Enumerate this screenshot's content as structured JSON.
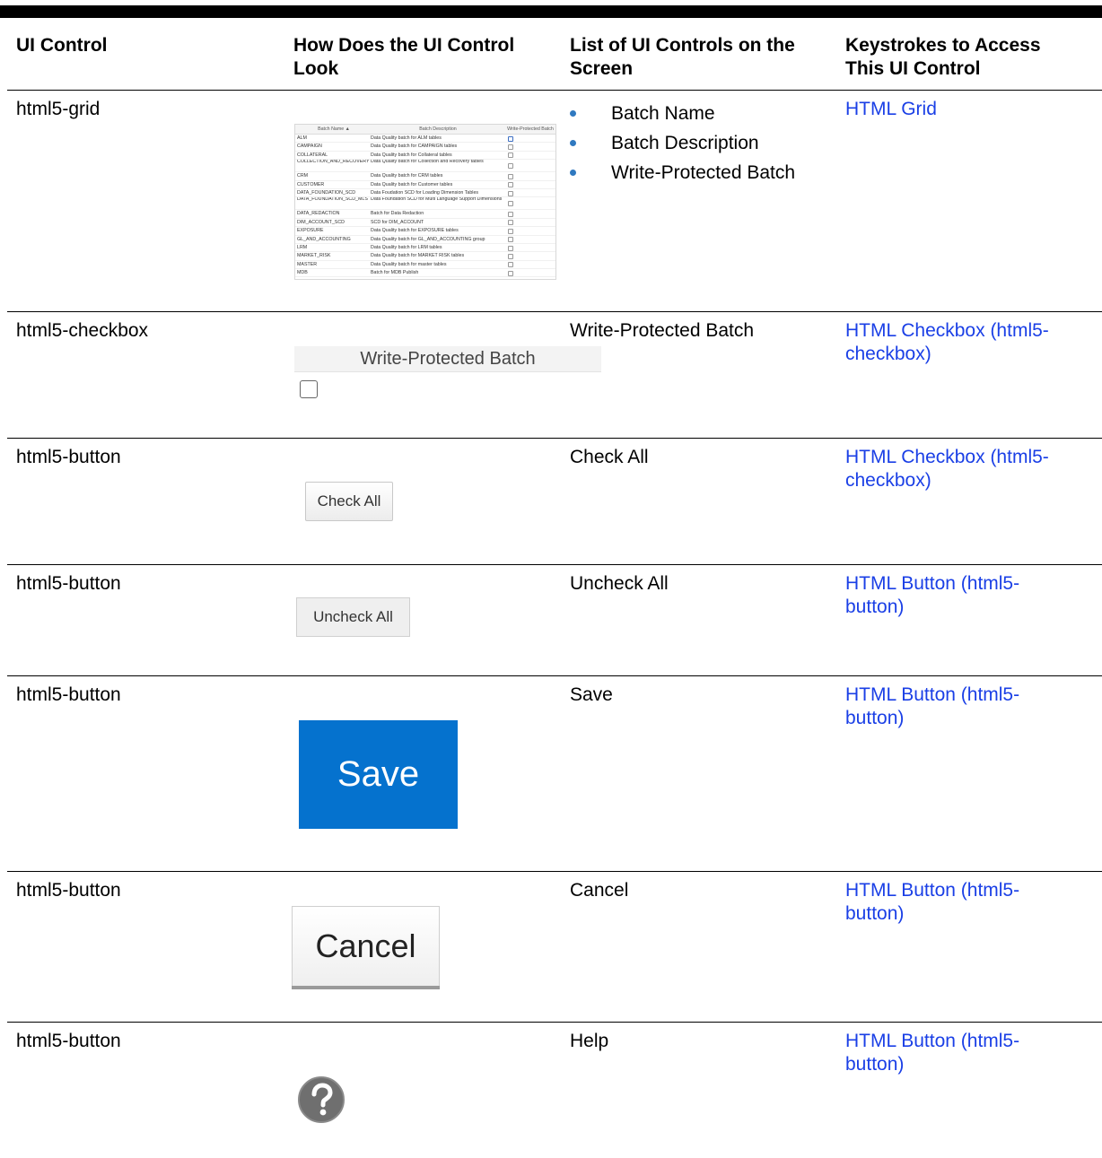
{
  "headers": {
    "col1": "UI Control",
    "col2a": "How Does the UI Control",
    "col2b": "Look",
    "col3a": "List of UI Controls on the",
    "col3b": "Screen",
    "col4a": "Keystrokes to Access",
    "col4b": "This UI Control"
  },
  "rows": [
    {
      "control": "html5-grid",
      "bullets": [
        "Batch Name",
        "Batch Description",
        "Write-Protected Batch"
      ],
      "link": [
        "HTML Grid"
      ]
    },
    {
      "control": "html5-checkbox",
      "list": "Write-Protected Batch",
      "visual_label": "Write-Protected Batch",
      "link": [
        "HTML Checkbox (html5-",
        "checkbox)"
      ]
    },
    {
      "control": "html5-button",
      "list": "Check All",
      "visual_label": "Check All",
      "link": [
        "HTML Checkbox (html5-",
        "checkbox)"
      ]
    },
    {
      "control": "html5-button",
      "list": "Uncheck All",
      "visual_label": "Uncheck All",
      "link": [
        "HTML Button (html5-",
        "button)"
      ]
    },
    {
      "control": "html5-button",
      "list": "Save",
      "visual_label": "Save",
      "link": [
        "HTML Button (html5-",
        "button)"
      ]
    },
    {
      "control": "html5-button",
      "list": "Cancel",
      "visual_label": "Cancel",
      "link": [
        "HTML Button (html5-",
        "button)"
      ]
    },
    {
      "control": "html5-button",
      "list": "Help",
      "visual_icon": "help-question-icon",
      "link": [
        "HTML Button (html5-",
        "button)"
      ]
    }
  ],
  "grid_preview": {
    "headers": [
      "Batch Name ▲",
      "Batch Description",
      "Write-Protected Batch"
    ],
    "rows": [
      {
        "name": "ALM",
        "desc": "Data Quality batch for ALM tables"
      },
      {
        "name": "CAMPAIGN",
        "desc": "Data Quality batch for CAMPAIGN tables"
      },
      {
        "name": "COLLATERAL",
        "desc": "Data Quality batch for Collateral tables"
      },
      {
        "name": "COLLECTION_AND_RECOVERY",
        "desc": "Data Quality batch for Collection and Recovery tables"
      },
      {
        "name": "CRM",
        "desc": "Data Quality batch for CRM tables"
      },
      {
        "name": "CUSTOMER",
        "desc": "Data Quality batch for Customer tables"
      },
      {
        "name": "DATA_FOUNDATION_SCD",
        "desc": "Data Foudation SCD for Loading Dimension Tables"
      },
      {
        "name": "DATA_FOUNDATION_SCD_MLS",
        "desc": "Data Foundation SCD for Multi Language Support Dimensions"
      },
      {
        "name": "DATA_REDACTION",
        "desc": "Batch for Data Redaction"
      },
      {
        "name": "DIM_ACCOUNT_SCD",
        "desc": "SCD for DIM_ACCOUNT"
      },
      {
        "name": "EXPOSURE",
        "desc": "Data Quality batch for EXPOSURE tables"
      },
      {
        "name": "GL_AND_ACCOUNTING",
        "desc": "Data Quality batch for GL_AND_ACCOUNTING group"
      },
      {
        "name": "LRM",
        "desc": "Data Quality batch for LRM tables"
      },
      {
        "name": "MARKET_RISK",
        "desc": "Data Quality batch for MARKET RISK tables"
      },
      {
        "name": "MASTER",
        "desc": "Data Quality batch for master tables"
      },
      {
        "name": "MDB",
        "desc": "Batch for MDB Publish"
      }
    ]
  },
  "colors": {
    "link": "#1a3fe6",
    "bullet": "#2f79c0",
    "save_button": "#0572ce"
  }
}
